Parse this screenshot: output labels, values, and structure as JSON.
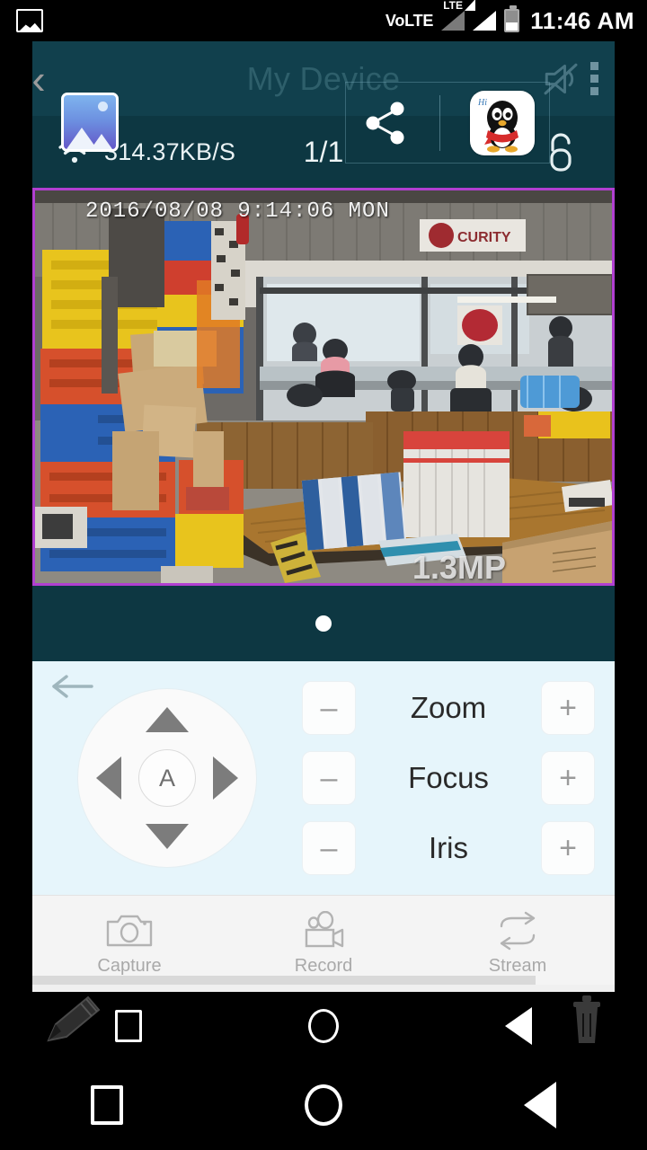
{
  "status_bar": {
    "gallery_icon": "gallery-icon",
    "volte_label": "VoLTE",
    "lte_label": "LTE",
    "signal_icon": "signal-bars-icon",
    "battery_icon": "battery-icon",
    "time": "11:46 AM"
  },
  "title_bar": {
    "back_icon": "back-chevron-icon",
    "title": "My Device",
    "share_icon": "share-icon",
    "app_icon_label": "QQ",
    "app_icon_hi": "Hi",
    "mute_icon": "mute-speaker-icon",
    "overflow_icon": "overflow-menu-icon"
  },
  "info_bar": {
    "wifi_icon": "wifi-icon",
    "speed": "314.37KB/S",
    "channel_count": "1/1",
    "lock_icon": "unlock-padlock-icon"
  },
  "video": {
    "timestamp": "2016/08/08 9:14:06 MON",
    "watermark": "1.3MP",
    "border_color": "#b13fd1",
    "sign_text": "SECURITY"
  },
  "pager": {
    "dot_count": 1,
    "active_index": 0
  },
  "ptz": {
    "back_icon": "back-arrow-icon",
    "up_icon": "arrow-up-icon",
    "down_icon": "arrow-down-icon",
    "left_icon": "arrow-left-icon",
    "right_icon": "arrow-right-icon",
    "auto_label": "A",
    "rows": [
      {
        "name": "zoom",
        "label": "Zoom",
        "minus": "–",
        "plus": "+"
      },
      {
        "name": "focus",
        "label": "Focus",
        "minus": "–",
        "plus": "+"
      },
      {
        "name": "iris",
        "label": "Iris",
        "minus": "–",
        "plus": "+"
      }
    ]
  },
  "toolbar": {
    "items": [
      {
        "name": "capture",
        "label": "Capture",
        "icon": "camera-icon"
      },
      {
        "name": "record",
        "label": "Record",
        "icon": "video-camera-icon"
      },
      {
        "name": "stream",
        "label": "Stream",
        "icon": "swap-arrows-icon"
      }
    ]
  },
  "nav_overlay": {
    "edit_icon": "pencil-icon",
    "delete_icon": "trash-icon"
  },
  "nav_bar": {
    "recents_icon": "square-recents-icon",
    "home_icon": "circle-home-icon",
    "back_icon": "triangle-back-icon"
  },
  "colors": {
    "header": "#11404d",
    "info_bar": "#0d3742",
    "ptz_panel": "#e6f5fb",
    "toolbar": "#f4f4f4",
    "video_border": "#b13fd1",
    "title_text": "#2e5f6b"
  }
}
